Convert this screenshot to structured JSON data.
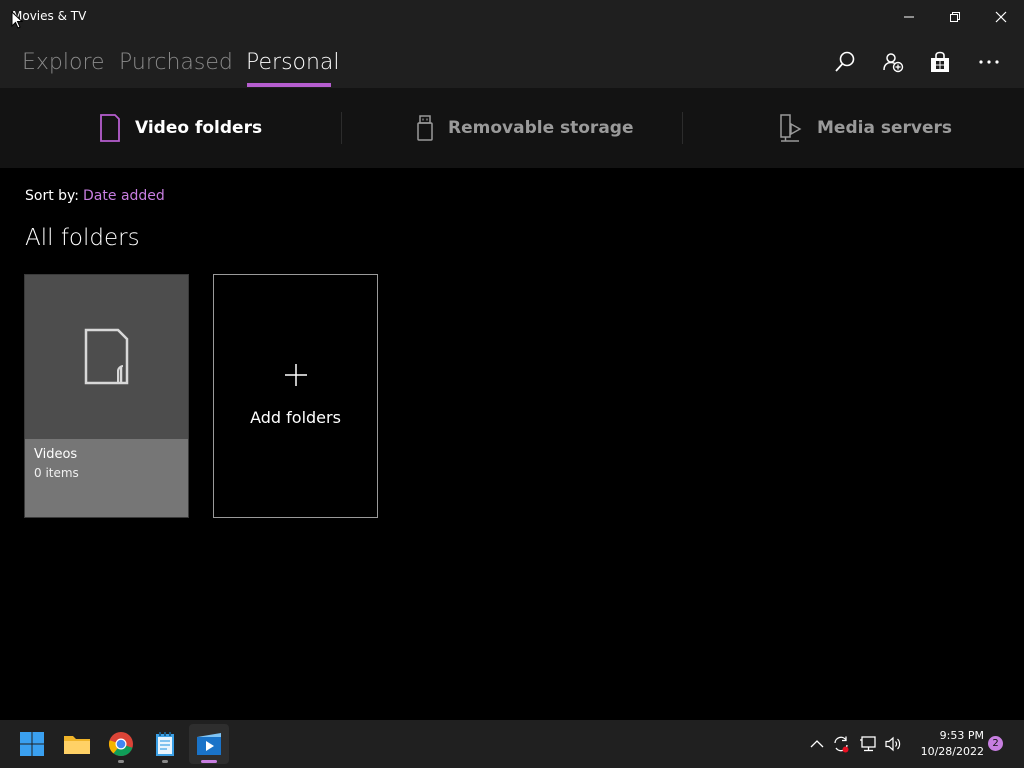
{
  "window": {
    "title": "Movies & TV"
  },
  "tabs": [
    {
      "label": "Explore"
    },
    {
      "label": "Purchased"
    },
    {
      "label": "Personal",
      "active": true
    }
  ],
  "header_icons": [
    "search-icon",
    "account-add-icon",
    "store-icon",
    "more-icon"
  ],
  "subnav": [
    {
      "label": "Video folders",
      "icon": "folder-outline-icon",
      "active": true
    },
    {
      "label": "Removable storage",
      "icon": "usb-drive-icon"
    },
    {
      "label": "Media servers",
      "icon": "media-server-icon"
    }
  ],
  "sort": {
    "label": "Sort by:",
    "value": "Date added"
  },
  "section_title": "All folders",
  "folders": [
    {
      "name": "Videos",
      "count": "0 items"
    }
  ],
  "add_folder": {
    "label": "Add folders"
  },
  "taskbar": {
    "apps": [
      "start-icon",
      "file-explorer-icon",
      "chrome-icon",
      "notepad-icon",
      "movies-tv-icon"
    ],
    "clock": {
      "time": "9:53 PM",
      "date": "10/28/2022"
    },
    "notifications": "2"
  },
  "colors": {
    "accent": "#b65ecf",
    "sort_value": "#c77ee0",
    "titlebar": "#1f1f1f",
    "taskbar": "#202020"
  }
}
